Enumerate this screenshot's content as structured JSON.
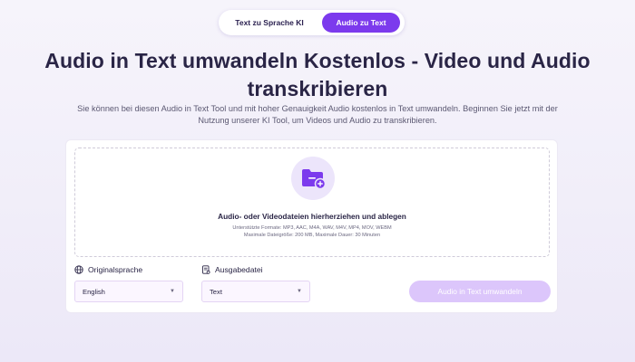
{
  "tabs": {
    "text_to_speech": "Text zu Sprache KI",
    "speech_to_text": "Audio zu Text"
  },
  "header": {
    "title": "Audio in Text umwandeln Kostenlos - Video und Audio transkribieren",
    "subtitle": "Sie können bei diesen Audio in Text Tool und mit hoher Genauigkeit Audio kostenlos in Text umwandeln. Beginnen Sie jetzt mit der Nutzung unserer KI Tool, um Videos und Audio zu transkribieren."
  },
  "upload": {
    "icon": "folder-plus-icon",
    "title": "Audio- oder Videodateien hierherziehen und ablegen",
    "formats": "Unterstützte Formate: MP3, AAC, M4A, WAV, M4V, MP4, MOV, WEBM",
    "limits": "Maximale Dateigröße: 200 MB, Maximale Dauer: 30 Minuten"
  },
  "options": {
    "language_label": "Originalsprache",
    "language_value": "English",
    "output_label": "Ausgabedatei",
    "output_value": "Text"
  },
  "actions": {
    "convert_label": "Audio in Text umwandeln"
  },
  "colors": {
    "accent": "#7c3aed",
    "button_disabled": "#dcc6fb",
    "icon_bg": "#ece5fb"
  }
}
